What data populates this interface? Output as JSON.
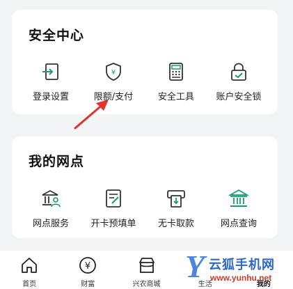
{
  "security": {
    "title": "安全中心",
    "items": [
      {
        "label": "登录设置",
        "icon": "login-icon"
      },
      {
        "label": "限额/支付",
        "icon": "shield-yuan-icon"
      },
      {
        "label": "安全工具",
        "icon": "calculator-icon"
      },
      {
        "label": "账户安全锁",
        "icon": "lock-icon"
      }
    ]
  },
  "outlets": {
    "title": "我的网点",
    "items": [
      {
        "label": "网点服务",
        "icon": "bank-person-icon"
      },
      {
        "label": "开卡预填单",
        "icon": "form-edit-icon"
      },
      {
        "label": "无卡取款",
        "icon": "atm-icon"
      },
      {
        "label": "网点查询",
        "icon": "bank-icon"
      }
    ]
  },
  "tabbar": {
    "tabs": [
      {
        "label": "首页",
        "icon": "home-icon"
      },
      {
        "label": "财富",
        "icon": "yuan-circle-icon"
      },
      {
        "label": "兴农商城",
        "icon": "shop-icon"
      },
      {
        "label": "生活",
        "icon": "life-icon"
      },
      {
        "label": "我的",
        "icon": "profile-icon"
      }
    ],
    "active": "我的"
  },
  "watermark": {
    "letter": "Y",
    "brand": "云狐手机网",
    "url": "www.yunhu.net"
  },
  "colors": {
    "icon_green": "#1a9b74",
    "icon_dark": "#333333",
    "annotation_red": "#e0342c",
    "background": "#f3f4f6"
  }
}
